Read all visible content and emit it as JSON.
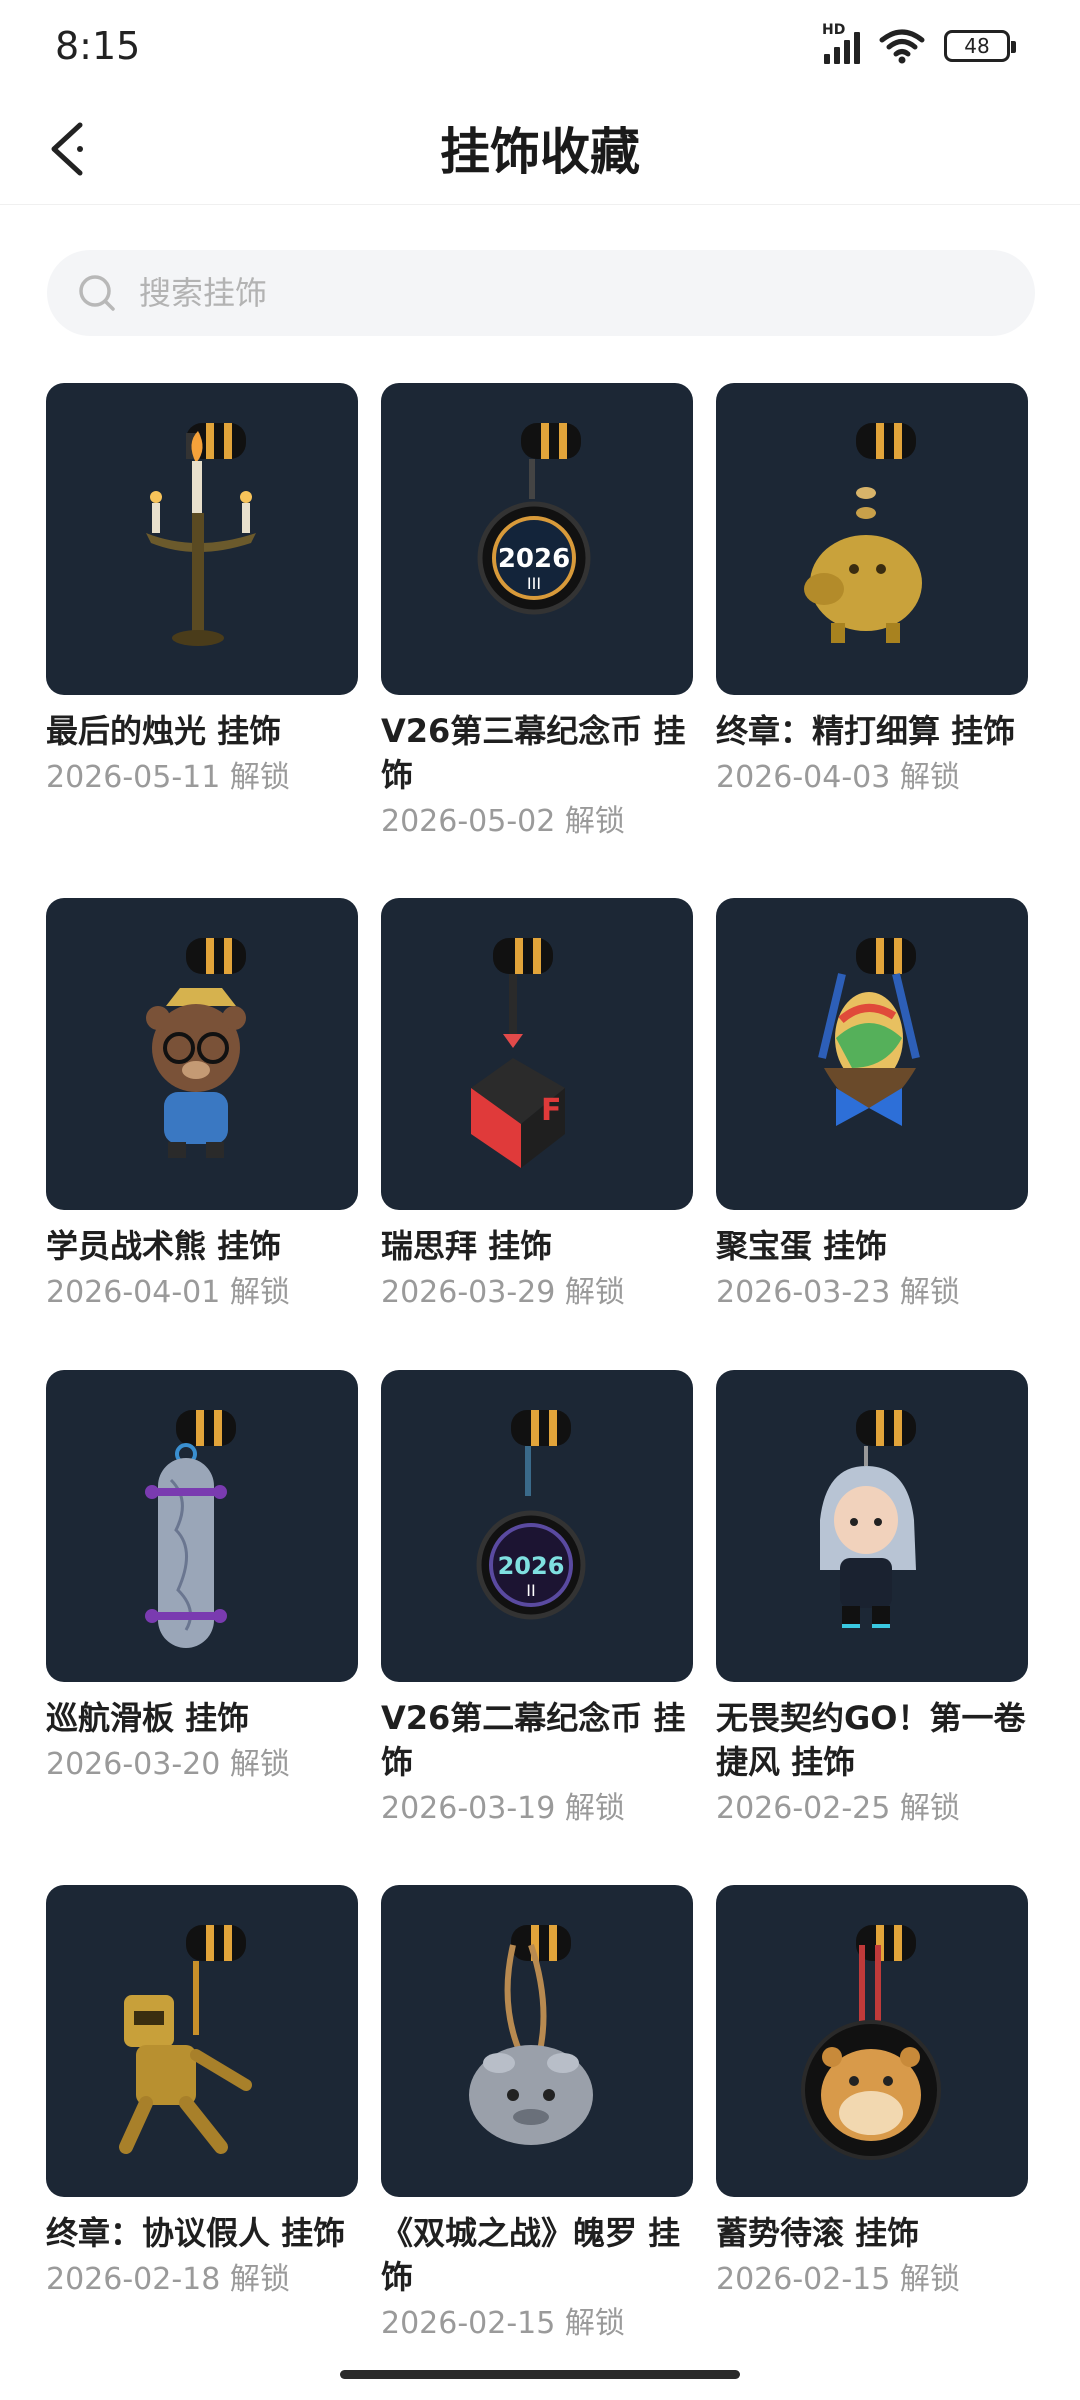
{
  "status": {
    "time": "8:15",
    "hd": "HD",
    "battery": "48"
  },
  "header": {
    "title": "挂饰收藏"
  },
  "search": {
    "placeholder": "搜索挂饰"
  },
  "items": [
    {
      "name": "最后的烛光 挂饰",
      "date": "2026-05-11 解锁",
      "icon": "candelabra-charm-icon"
    },
    {
      "name": "V26第三幕纪念币 挂饰",
      "date": "2026-05-02 解锁",
      "icon": "coin-2026-iii-charm-icon"
    },
    {
      "name": "终章：精打细算 挂饰",
      "date": "2026-04-03 解锁",
      "icon": "gold-piggy-bank-charm-icon"
    },
    {
      "name": "学员战术熊 挂饰",
      "date": "2026-04-01 解锁",
      "icon": "tactical-bear-charm-icon"
    },
    {
      "name": "瑞思拜 挂饰",
      "date": "2026-03-29 解锁",
      "icon": "red-cube-charm-icon"
    },
    {
      "name": "聚宝蛋 挂饰",
      "date": "2026-03-23 解锁",
      "icon": "egg-basket-charm-icon"
    },
    {
      "name": "巡航滑板 挂饰",
      "date": "2026-03-20 解锁",
      "icon": "skateboard-charm-icon"
    },
    {
      "name": "V26第二幕纪念币 挂饰",
      "date": "2026-03-19 解锁",
      "icon": "coin-2026-ii-charm-icon"
    },
    {
      "name": "无畏契约GO！第一卷 捷风 挂饰",
      "date": "2026-02-25 解锁",
      "icon": "jett-figure-charm-icon"
    },
    {
      "name": "终章：协议假人 挂饰",
      "date": "2026-02-18 解锁",
      "icon": "gold-dummy-charm-icon"
    },
    {
      "name": "《双城之战》魄罗 挂饰",
      "date": "2026-02-15 解锁",
      "icon": "poro-charm-icon"
    },
    {
      "name": "蓄势待滚 挂饰",
      "date": "2026-02-15 解锁",
      "icon": "hamster-charm-icon"
    }
  ],
  "colors": {
    "card_bg": "#1c2735",
    "accent_gold": "#e2a43a",
    "date_text": "#9a9a9a"
  }
}
